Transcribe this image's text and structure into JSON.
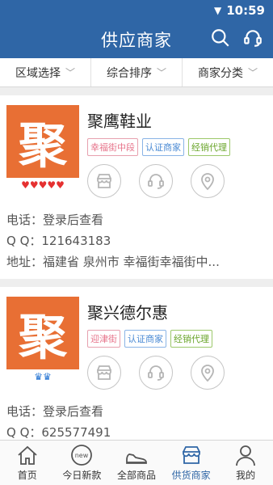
{
  "status": {
    "time": "10:59"
  },
  "header": {
    "title": "供应商家"
  },
  "filters": [
    {
      "label": "区域选择"
    },
    {
      "label": "综合排序"
    },
    {
      "label": "商家分类"
    }
  ],
  "merchants": [
    {
      "logo_char": "聚",
      "name": "聚鹰鞋业",
      "rating_symbols": "♥♥♥♥♥",
      "tags": [
        "幸福街中段",
        "认证商家",
        "经销代理"
      ],
      "phone": "电话：登录后查看",
      "qq": "Q Q：121643183",
      "address": "地址：福建省 泉州市 幸福街幸福街中..."
    },
    {
      "logo_char": "聚",
      "name": "聚兴德尔惠",
      "rating_symbols": "♛♛",
      "tags": [
        "迎津街",
        "认证商家",
        "经销代理"
      ],
      "phone": "电话：登录后查看",
      "qq": "Q Q：625577491"
    }
  ],
  "tabbar": [
    {
      "label": "首页"
    },
    {
      "label": "今日新款"
    },
    {
      "label": "全部商品"
    },
    {
      "label": "供货商家"
    },
    {
      "label": "我的"
    }
  ],
  "colors": {
    "primary": "#2f66a6",
    "logo_bg": "#e86f34"
  }
}
